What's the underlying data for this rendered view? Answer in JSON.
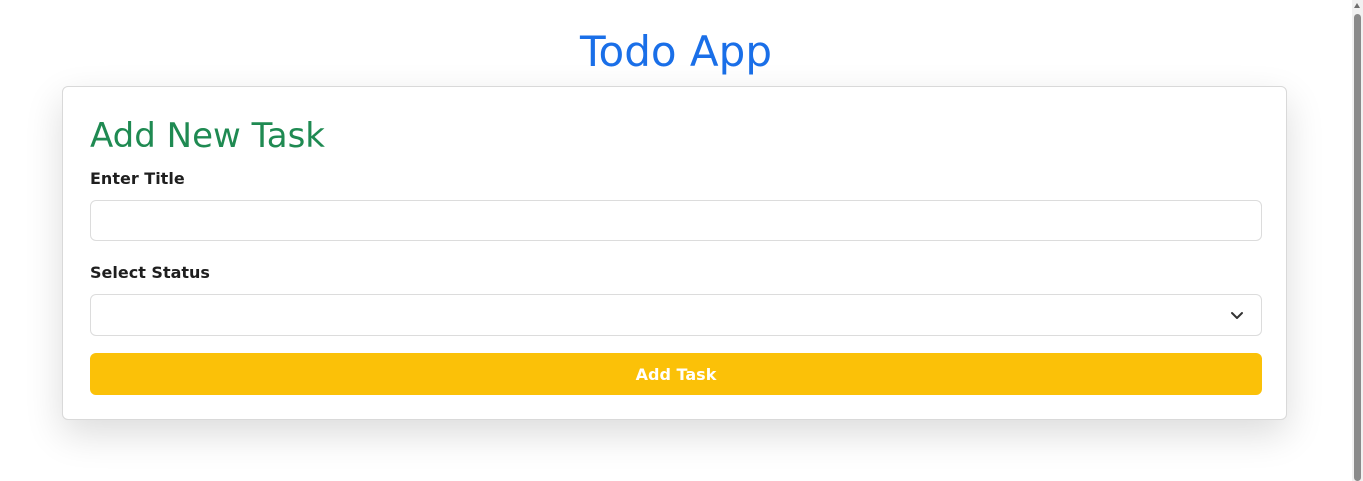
{
  "header": {
    "title": "Todo App"
  },
  "form": {
    "heading": "Add New Task",
    "title_label": "Enter Title",
    "title_value": "",
    "status_label": "Select Status",
    "status_value": "",
    "submit_label": "Add Task"
  },
  "icons": {
    "select_arrow": "chevron-down-icon",
    "scroll_up": "scroll-up-arrow-icon"
  },
  "colors": {
    "app_title": "#1a6fe8",
    "form_heading": "#1f8a52",
    "submit_button": "#fbc108",
    "submit_text": "#ffffff"
  }
}
